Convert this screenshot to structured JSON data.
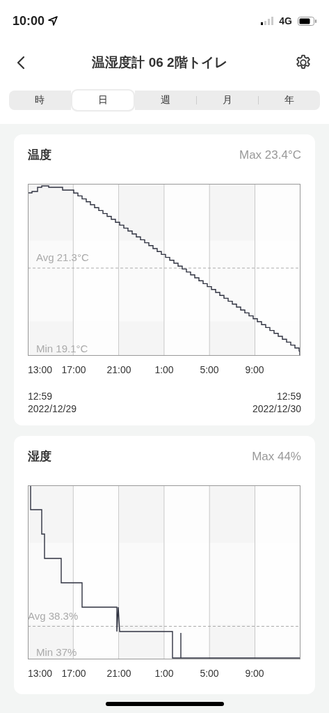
{
  "status_bar": {
    "time": "10:00",
    "network": "4G"
  },
  "header": {
    "title": "温湿度計 06 2階トイレ"
  },
  "tabs": [
    {
      "label": "時",
      "selected": false
    },
    {
      "label": "日",
      "selected": true
    },
    {
      "label": "週",
      "selected": false
    },
    {
      "label": "月",
      "selected": false
    },
    {
      "label": "年",
      "selected": false
    }
  ],
  "cards": [
    {
      "kind": "temperature",
      "title": "温度",
      "max": "Max 23.4°C",
      "avg": "Avg 21.3°C",
      "min": "Min 19.1°C",
      "x_labels": [
        "13:00",
        "17:00",
        "21:00",
        "1:00",
        "5:00",
        "9:00"
      ],
      "range_start": {
        "time": "12:59",
        "date": "2022/12/29"
      },
      "range_end": {
        "time": "12:59",
        "date": "2022/12/30"
      }
    },
    {
      "kind": "humidity",
      "title": "湿度",
      "max": "Max 44%",
      "avg": "Avg 38.3%",
      "min": "Min 37%",
      "x_labels": [
        "13:00",
        "17:00",
        "21:00",
        "1:00",
        "5:00",
        "9:00"
      ]
    }
  ]
}
